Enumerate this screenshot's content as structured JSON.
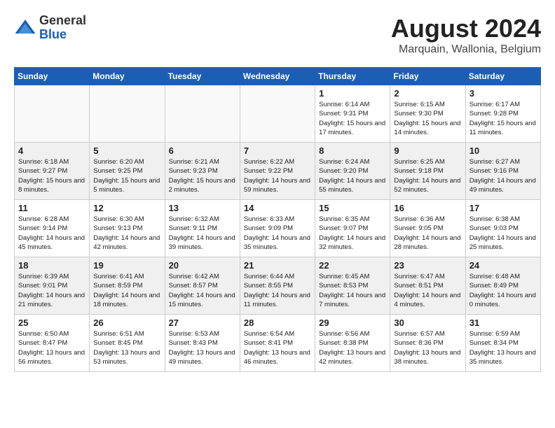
{
  "header": {
    "logo_general": "General",
    "logo_blue": "Blue",
    "month_year": "August 2024",
    "location": "Marquain, Wallonia, Belgium"
  },
  "days_of_week": [
    "Sunday",
    "Monday",
    "Tuesday",
    "Wednesday",
    "Thursday",
    "Friday",
    "Saturday"
  ],
  "weeks": [
    [
      {
        "day": "",
        "info": "",
        "empty": true
      },
      {
        "day": "",
        "info": "",
        "empty": true
      },
      {
        "day": "",
        "info": "",
        "empty": true
      },
      {
        "day": "",
        "info": "",
        "empty": true
      },
      {
        "day": "1",
        "info": "Sunrise: 6:14 AM\nSunset: 9:31 PM\nDaylight: 15 hours\nand 17 minutes."
      },
      {
        "day": "2",
        "info": "Sunrise: 6:15 AM\nSunset: 9:30 PM\nDaylight: 15 hours\nand 14 minutes."
      },
      {
        "day": "3",
        "info": "Sunrise: 6:17 AM\nSunset: 9:28 PM\nDaylight: 15 hours\nand 11 minutes."
      }
    ],
    [
      {
        "day": "4",
        "info": "Sunrise: 6:18 AM\nSunset: 9:27 PM\nDaylight: 15 hours\nand 8 minutes.",
        "shaded": true
      },
      {
        "day": "5",
        "info": "Sunrise: 6:20 AM\nSunset: 9:25 PM\nDaylight: 15 hours\nand 5 minutes.",
        "shaded": true
      },
      {
        "day": "6",
        "info": "Sunrise: 6:21 AM\nSunset: 9:23 PM\nDaylight: 15 hours\nand 2 minutes.",
        "shaded": true
      },
      {
        "day": "7",
        "info": "Sunrise: 6:22 AM\nSunset: 9:22 PM\nDaylight: 14 hours\nand 59 minutes.",
        "shaded": true
      },
      {
        "day": "8",
        "info": "Sunrise: 6:24 AM\nSunset: 9:20 PM\nDaylight: 14 hours\nand 55 minutes.",
        "shaded": true
      },
      {
        "day": "9",
        "info": "Sunrise: 6:25 AM\nSunset: 9:18 PM\nDaylight: 14 hours\nand 52 minutes.",
        "shaded": true
      },
      {
        "day": "10",
        "info": "Sunrise: 6:27 AM\nSunset: 9:16 PM\nDaylight: 14 hours\nand 49 minutes.",
        "shaded": true
      }
    ],
    [
      {
        "day": "11",
        "info": "Sunrise: 6:28 AM\nSunset: 9:14 PM\nDaylight: 14 hours\nand 45 minutes."
      },
      {
        "day": "12",
        "info": "Sunrise: 6:30 AM\nSunset: 9:13 PM\nDaylight: 14 hours\nand 42 minutes."
      },
      {
        "day": "13",
        "info": "Sunrise: 6:32 AM\nSunset: 9:11 PM\nDaylight: 14 hours\nand 39 minutes."
      },
      {
        "day": "14",
        "info": "Sunrise: 6:33 AM\nSunset: 9:09 PM\nDaylight: 14 hours\nand 35 minutes."
      },
      {
        "day": "15",
        "info": "Sunrise: 6:35 AM\nSunset: 9:07 PM\nDaylight: 14 hours\nand 32 minutes."
      },
      {
        "day": "16",
        "info": "Sunrise: 6:36 AM\nSunset: 9:05 PM\nDaylight: 14 hours\nand 28 minutes."
      },
      {
        "day": "17",
        "info": "Sunrise: 6:38 AM\nSunset: 9:03 PM\nDaylight: 14 hours\nand 25 minutes."
      }
    ],
    [
      {
        "day": "18",
        "info": "Sunrise: 6:39 AM\nSunset: 9:01 PM\nDaylight: 14 hours\nand 21 minutes.",
        "shaded": true
      },
      {
        "day": "19",
        "info": "Sunrise: 6:41 AM\nSunset: 8:59 PM\nDaylight: 14 hours\nand 18 minutes.",
        "shaded": true
      },
      {
        "day": "20",
        "info": "Sunrise: 6:42 AM\nSunset: 8:57 PM\nDaylight: 14 hours\nand 15 minutes.",
        "shaded": true
      },
      {
        "day": "21",
        "info": "Sunrise: 6:44 AM\nSunset: 8:55 PM\nDaylight: 14 hours\nand 11 minutes.",
        "shaded": true
      },
      {
        "day": "22",
        "info": "Sunrise: 6:45 AM\nSunset: 8:53 PM\nDaylight: 14 hours\nand 7 minutes.",
        "shaded": true
      },
      {
        "day": "23",
        "info": "Sunrise: 6:47 AM\nSunset: 8:51 PM\nDaylight: 14 hours\nand 4 minutes.",
        "shaded": true
      },
      {
        "day": "24",
        "info": "Sunrise: 6:48 AM\nSunset: 8:49 PM\nDaylight: 14 hours\nand 0 minutes.",
        "shaded": true
      }
    ],
    [
      {
        "day": "25",
        "info": "Sunrise: 6:50 AM\nSunset: 8:47 PM\nDaylight: 13 hours\nand 56 minutes."
      },
      {
        "day": "26",
        "info": "Sunrise: 6:51 AM\nSunset: 8:45 PM\nDaylight: 13 hours\nand 53 minutes."
      },
      {
        "day": "27",
        "info": "Sunrise: 6:53 AM\nSunset: 8:43 PM\nDaylight: 13 hours\nand 49 minutes."
      },
      {
        "day": "28",
        "info": "Sunrise: 6:54 AM\nSunset: 8:41 PM\nDaylight: 13 hours\nand 46 minutes."
      },
      {
        "day": "29",
        "info": "Sunrise: 6:56 AM\nSunset: 8:38 PM\nDaylight: 13 hours\nand 42 minutes."
      },
      {
        "day": "30",
        "info": "Sunrise: 6:57 AM\nSunset: 8:36 PM\nDaylight: 13 hours\nand 38 minutes."
      },
      {
        "day": "31",
        "info": "Sunrise: 6:59 AM\nSunset: 8:34 PM\nDaylight: 13 hours\nand 35 minutes."
      }
    ]
  ]
}
